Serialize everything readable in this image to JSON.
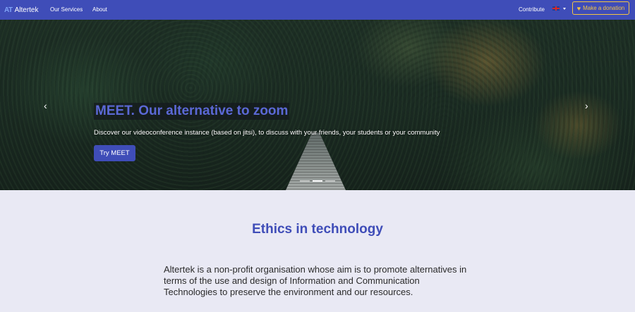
{
  "navbar": {
    "brand_logo": "AT",
    "brand_name": "Altertek",
    "links": [
      "Our Services",
      "About"
    ],
    "contribute": "Contribute",
    "donate_label": "Make a donation",
    "donate_icon": "heart-icon",
    "lang_icon": "uk-flag-icon"
  },
  "hero": {
    "title": "MEET. Our alternative to zoom",
    "description": "Discover our videoconference instance (based on jitsi), to discuss with your friends, your students or your community",
    "button_label": "Try MEET",
    "prev_icon": "chevron-left-icon",
    "next_icon": "chevron-right-icon",
    "slides_count": 3,
    "active_slide": 2
  },
  "ethics": {
    "title": "Ethics in technology",
    "text": "Altertek is a non-profit organisation whose aim is to promote alternatives in terms of the use and design of Information and Communication Technologies to preserve the environment and our resources."
  },
  "colors": {
    "primary": "#3f4db8",
    "donate": "#f4c542",
    "background": "#e9e9f4"
  }
}
